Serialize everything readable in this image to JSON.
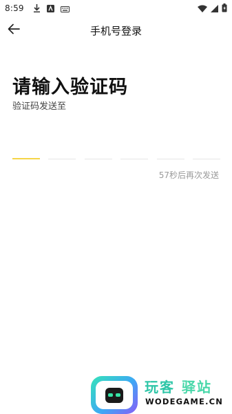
{
  "status_bar": {
    "time": "8:59",
    "left_icons": [
      "download-icon",
      "app-notification-icon",
      "keyboard-icon"
    ],
    "right_icons": [
      "wifi-icon",
      "cellular-signal-icon",
      "battery-icon"
    ]
  },
  "app_bar": {
    "back_icon": "arrow-left-icon",
    "title": "手机号登录"
  },
  "verification": {
    "heading": "请输入验证码",
    "subheading": "验证码发送至",
    "code_length": 6,
    "active_slot_color": "#f5d547",
    "slots": [
      "",
      "",
      "",
      "",
      "",
      ""
    ],
    "resend_text": "57秒后再次发送"
  },
  "watermark": {
    "title_part1": "玩客",
    "title_part2": "驿站",
    "domain": "WODEGAME.CN"
  }
}
